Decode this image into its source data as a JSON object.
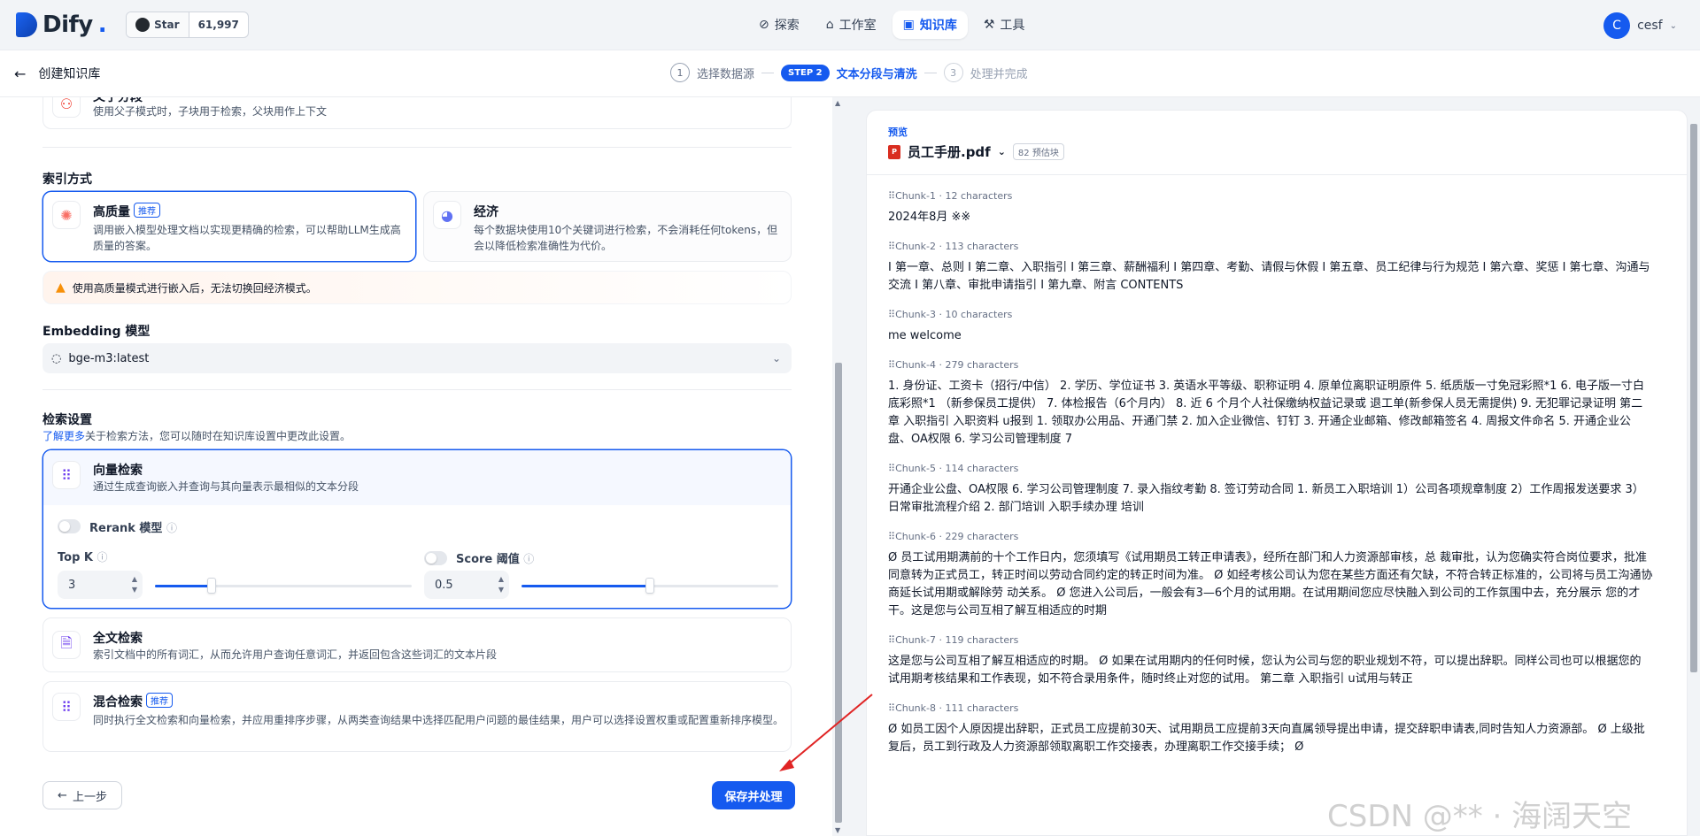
{
  "topbar": {
    "logo_text": "Dify",
    "logo_suffix": ".",
    "github_star_label": "Star",
    "github_star_count": "61,997",
    "nav": [
      {
        "label": "探索",
        "icon": "compass-icon",
        "active": false
      },
      {
        "label": "工作室",
        "icon": "robot-icon",
        "active": false
      },
      {
        "label": "知识库",
        "icon": "book-icon",
        "active": true
      },
      {
        "label": "工具",
        "icon": "hammer-icon",
        "active": false
      }
    ],
    "user_initial": "C",
    "user_name": "cesf"
  },
  "subbar": {
    "title": "创建知识库",
    "steps": [
      {
        "num": "1",
        "label": "选择数据源"
      },
      {
        "badge": "STEP 2",
        "label": "文本分段与清洗"
      },
      {
        "num": "3",
        "label": "处理并完成"
      }
    ]
  },
  "left": {
    "parent_child": {
      "title": "父子分段",
      "desc": "使用父子模式时，子块用于检索，父块用作上下文"
    },
    "index_heading": "索引方式",
    "high_quality": {
      "title": "高质量",
      "tag": "推荐",
      "desc": "调用嵌入模型处理文档以实现更精确的检索，可以帮助LLM生成高质量的答案。"
    },
    "economy": {
      "title": "经济",
      "desc": "每个数据块使用10个关键词进行检索，不会消耗任何tokens，但会以降低检索准确性为代价。"
    },
    "warning": "使用高质量模式进行嵌入后，无法切换回经济模式。",
    "embedding_heading": "Embedding 模型",
    "embedding_model": "bge-m3:latest",
    "retrieval_heading": "检索设置",
    "retrieval_link": "了解更多",
    "retrieval_note": "关于检索方法，您可以随时在知识库设置中更改此设置。",
    "vector": {
      "title": "向量检索",
      "desc": "通过生成查询嵌入并查询与其向量表示最相似的文本分段"
    },
    "rerank_label": "Rerank 模型",
    "topk_label": "Top K",
    "topk_value": "3",
    "topk_fraction": 0.22,
    "score_label": "Score 阈值",
    "score_value": "0.5",
    "score_fraction": 0.5,
    "fulltext": {
      "title": "全文检索",
      "desc": "索引文档中的所有词汇，从而允许用户查询任意词汇，并返回包含这些词汇的文本片段"
    },
    "hybrid": {
      "title": "混合检索",
      "tag": "推荐",
      "desc": "同时执行全文检索和向量检索，并应用重排序步骤，从两类查询结果中选择匹配用户问题的最佳结果，用户可以选择设置权重或配置重新排序模型。"
    },
    "prev_button": "上一步",
    "save_button": "保存并处理"
  },
  "preview": {
    "label": "预览",
    "file_name": "员工手册.pdf",
    "chunk_count": "82 预估块",
    "chunks": [
      {
        "head": "Chunk-1 · 12 characters",
        "text": "2024年8月 ※※"
      },
      {
        "head": "Chunk-2 · 113 characters",
        "text": "I 第一章、总则 I 第二章、入职指引 I 第三章、薪酬福利 I 第四章、考勤、请假与休假 I 第五章、员工纪律与行为规范 I 第六章、奖惩 I 第七章、沟通与交流 I 第八章、审批申请指引 I 第九章、附言 CONTENTS"
      },
      {
        "head": "Chunk-3 · 10 characters",
        "text": "me welcome"
      },
      {
        "head": "Chunk-4 · 279 characters",
        "text": "1. 身份证、工资卡（招行/中信） 2. 学历、学位证书 3. 英语水平等级、职称证明 4. 原单位离职证明原件 5. 纸质版一寸免冠彩照*1 6. 电子版一寸白底彩照*1 （新参保员工提供） 7. 体检报告（6个月内） 8. 近 6 个月个人社保缴纳权益记录或 退工单(新参保人员无需提供) 9. 无犯罪记录证明 第二章 入职指引 入职资料 u报到 1. 领取办公用品、开通门禁 2. 加入企业微信、钉钉 3. 开通企业邮箱、修改邮箱签名 4. 周报文件命名 5. 开通企业公盘、OA权限 6. 学习公司管理制度 7"
      },
      {
        "head": "Chunk-5 · 114 characters",
        "text": "开通企业公盘、OA权限 6. 学习公司管理制度 7. 录入指纹考勤 8. 签订劳动合同 1. 新员工入职培训 1）公司各项规章制度 2）工作周报发送要求 3）日常审批流程介绍 2. 部门培训 入职手续办理 培训"
      },
      {
        "head": "Chunk-6 · 229 characters",
        "text": "Ø 员工试用期满前的十个工作日内，您须填写《试用期员工转正申请表》，经所在部门和人力资源部审核，总 裁审批，认为您确实符合岗位要求，批准同意转为正式员工，转正时间以劳动合同约定的转正时间为准。 Ø 如经考核公司认为您在某些方面还有欠缺，不符合转正标准的，公司将与员工沟通协商延长试用期或解除劳 动关系。 Ø 您进入公司后，一般会有3—6个月的试用期。在试用期间您应尽快融入到公司的工作氛围中去，充分展示 您的才干。这是您与公司互相了解互相适应的时期"
      },
      {
        "head": "Chunk-7 · 119 characters",
        "text": "这是您与公司互相了解互相适应的时期。 Ø 如果在试用期内的任何时候，您认为公司与您的职业规划不符，可以提出辞职。同样公司也可以根据您的 试用期考核结果和工作表现，如不符合录用条件，随时终止对您的试用。 第二章 入职指引 u试用与转正"
      },
      {
        "head": "Chunk-8 · 111 characters",
        "text": "Ø 如员工因个人原因提出辞职，正式员工应提前30天、试用期员工应提前3天向直属领导提出申请，提交辞职申请表,同时告知人力资源部。 Ø 上级批复后，员工到行政及人力资源部领取离职工作交接表，办理离职工作交接手续； Ø"
      }
    ],
    "watermark": "CSDN @** · 海阔天空"
  }
}
